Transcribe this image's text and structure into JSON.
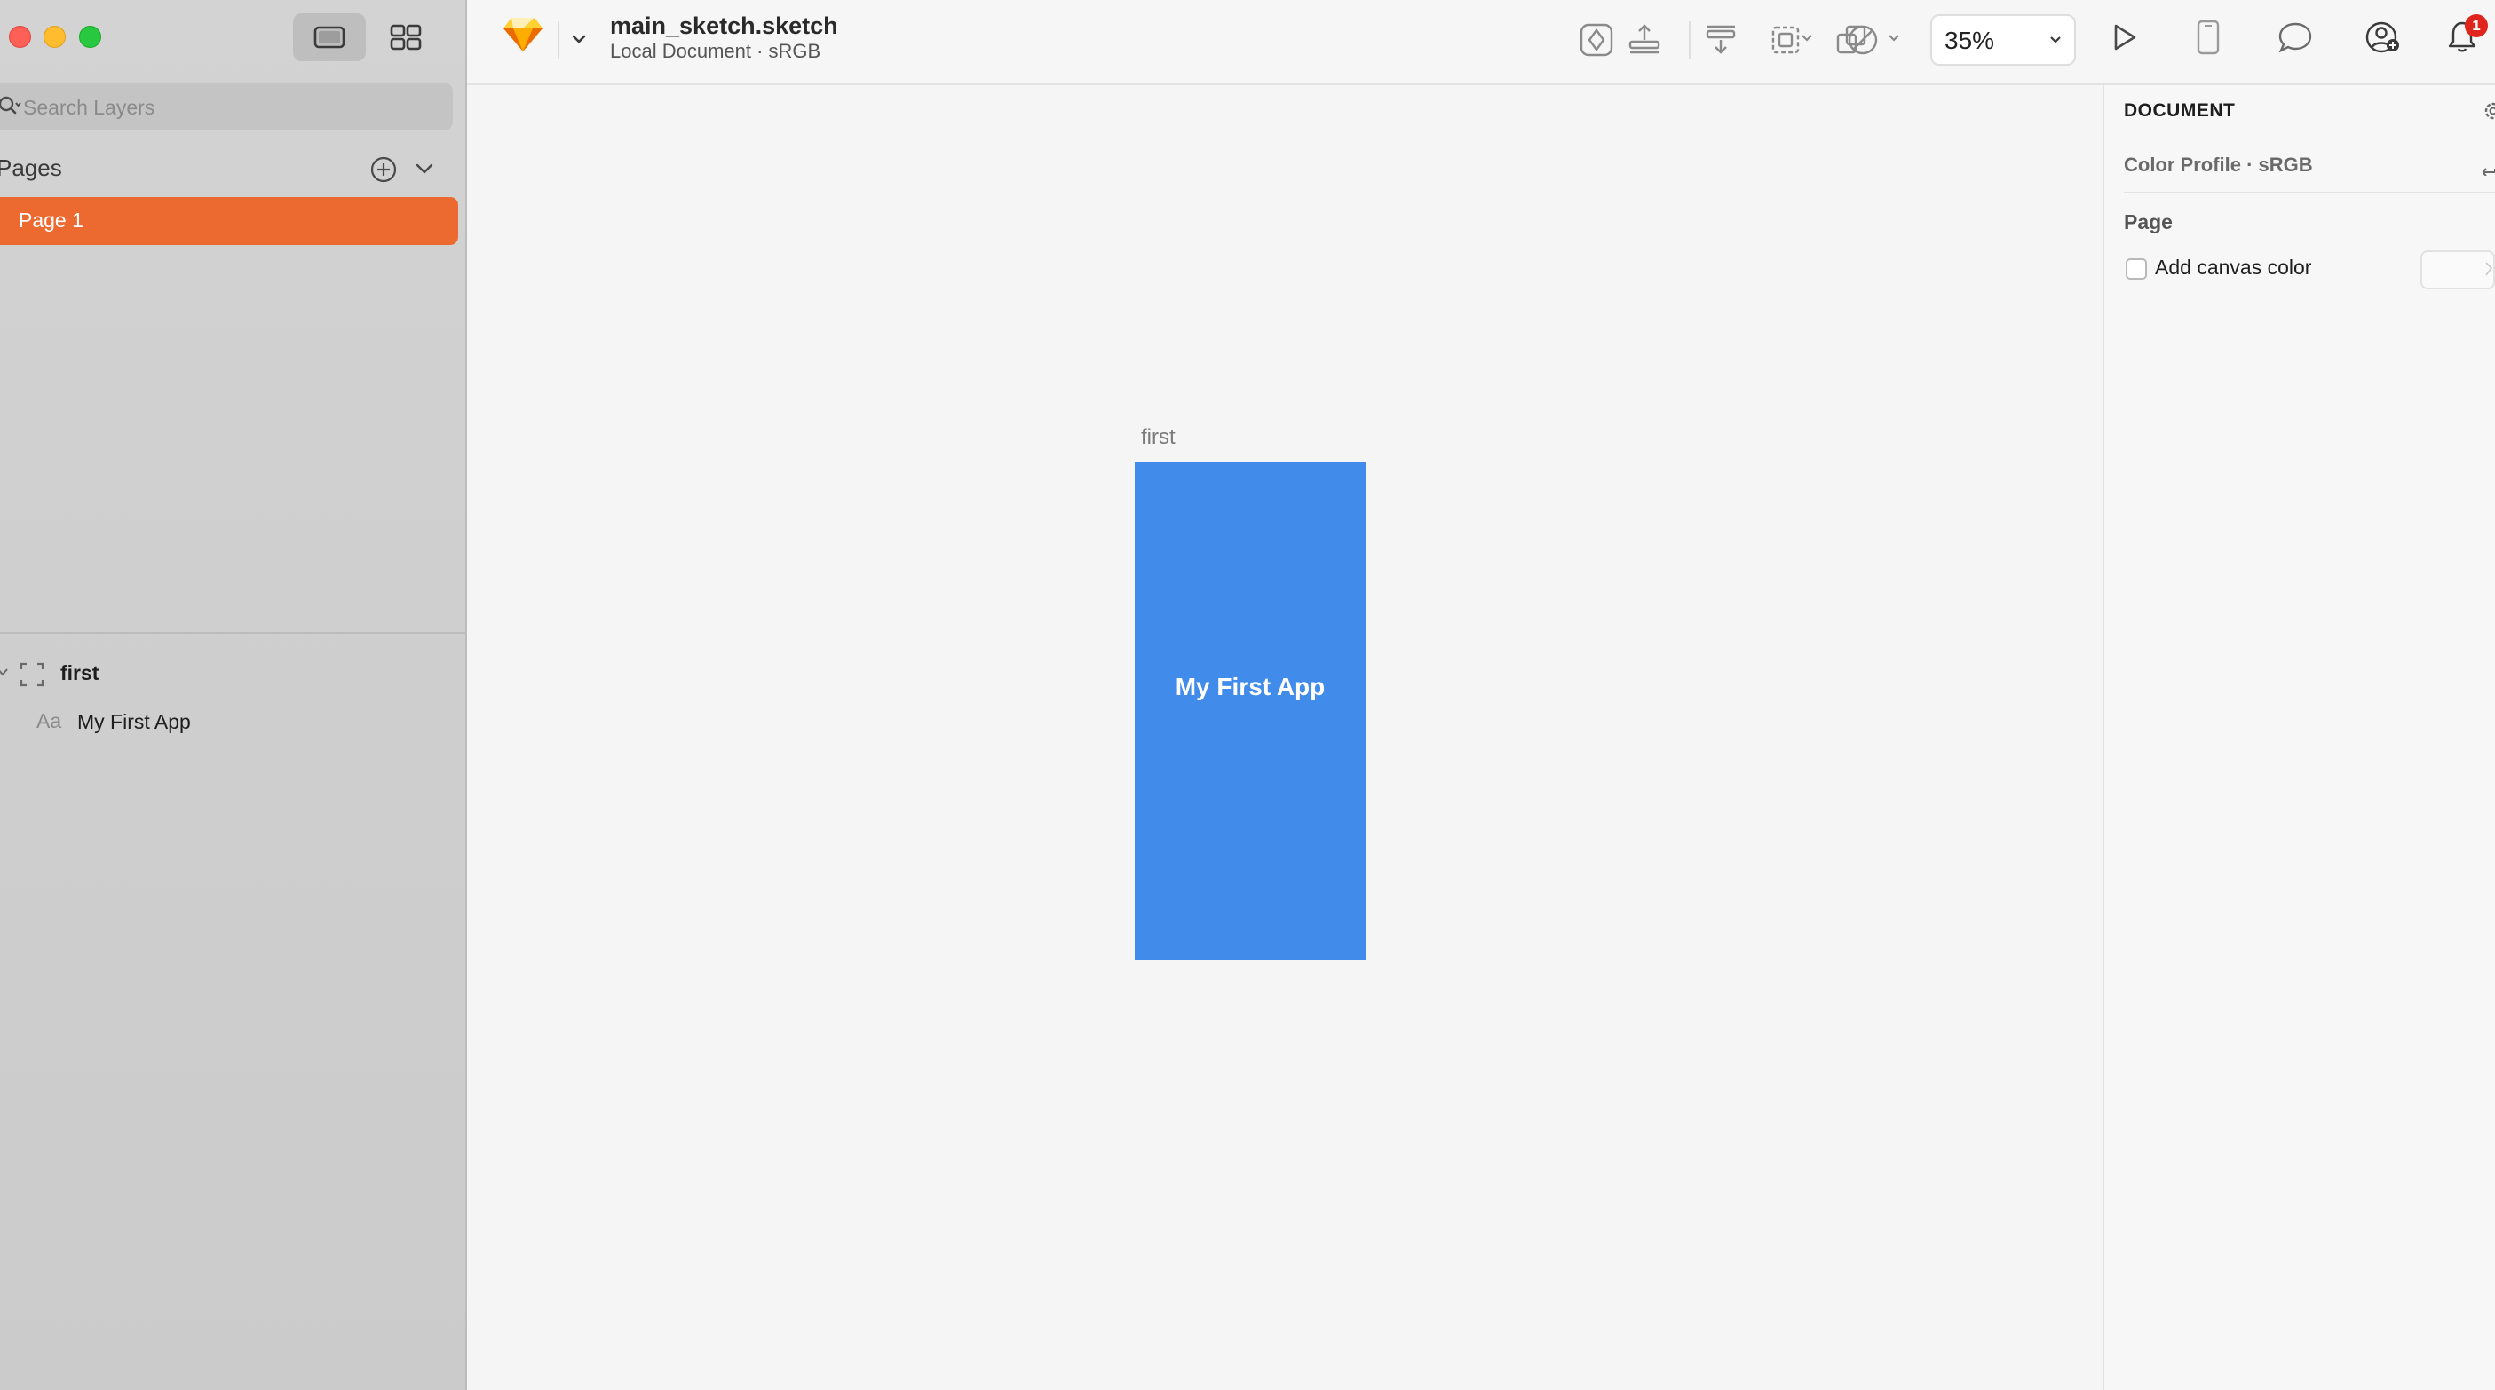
{
  "window": {
    "traffic_lights": [
      "close",
      "minimize",
      "zoom"
    ]
  },
  "sidebar": {
    "search_placeholder": "Search Layers",
    "pages_title": "Pages",
    "pages": [
      {
        "label": "Page 1",
        "selected": true
      }
    ],
    "layers": [
      {
        "label": "first",
        "type": "artboard",
        "expanded": true
      },
      {
        "label": "My First App",
        "type": "text",
        "prefix": "Aa"
      }
    ]
  },
  "toolbar": {
    "doc_title": "main_sketch.sketch",
    "doc_subtitle": "Local Document · sRGB",
    "zoom": "35%",
    "notification_count": "1",
    "accent_color": "#ec6a2f"
  },
  "canvas": {
    "artboard_label": "first",
    "artboard_text": "My First App",
    "artboard_color": "#418bea"
  },
  "inspector": {
    "heading": "DOCUMENT",
    "color_profile": "Color Profile · sRGB",
    "page_section": "Page",
    "canvas_color_label": "Add canvas color",
    "canvas_color_checked": false
  }
}
